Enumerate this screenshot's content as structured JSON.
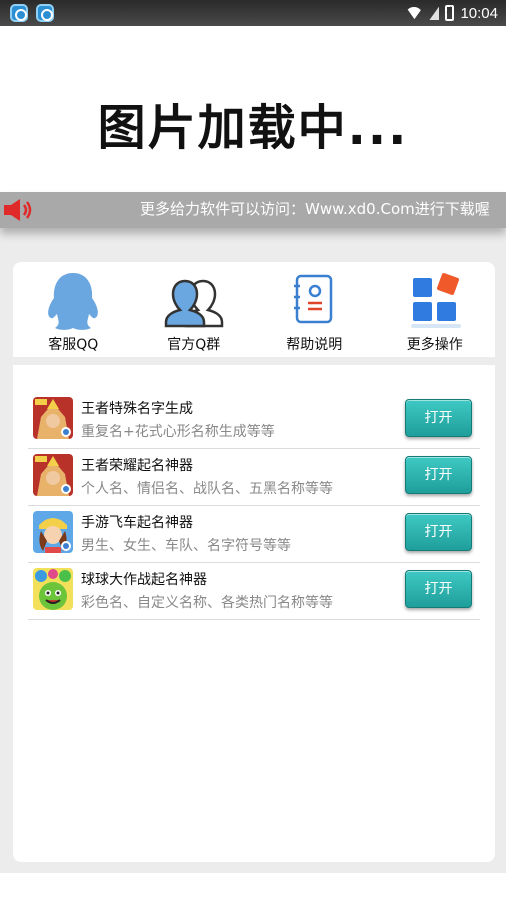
{
  "status_bar": {
    "time": "10:04",
    "notification_icons": [
      "app-notification-icon",
      "app-notification-icon"
    ]
  },
  "banner": {
    "loading_text": "图片加载中..."
  },
  "marquee": {
    "text": "更多给力软件可以访问：Www.xd0.Com进行下载喔",
    "icon": "speaker-icon",
    "icon_color": "#e02a2a"
  },
  "menu": {
    "items": [
      {
        "label": "客服QQ",
        "icon": "qq-penguin-icon"
      },
      {
        "label": "官方Q群",
        "icon": "user-group-icon"
      },
      {
        "label": "帮助说明",
        "icon": "help-document-icon"
      },
      {
        "label": "更多操作",
        "icon": "more-grid-icon"
      }
    ]
  },
  "apps": {
    "items": [
      {
        "title": "王者特殊名字生成",
        "desc": "重复名+花式心形名称生成等等",
        "button": "打开",
        "icon": "game-hero-icon"
      },
      {
        "title": "王者荣耀起名神器",
        "desc": "个人名、情侣名、战队名、五黑名称等等",
        "button": "打开",
        "icon": "game-hero-icon"
      },
      {
        "title": "手游飞车起名神器",
        "desc": "男生、女生、车队、名字符号等等",
        "button": "打开",
        "icon": "racer-avatar-icon"
      },
      {
        "title": "球球大作战起名神器",
        "desc": "彩色名、自定义名称、各类热门名称等等",
        "button": "打开",
        "icon": "ball-battle-icon"
      }
    ]
  },
  "colors": {
    "accent_button": "#2cb5b0",
    "marquee_bg": "#a9a9a9",
    "icon_blue": "#6aa6df"
  }
}
